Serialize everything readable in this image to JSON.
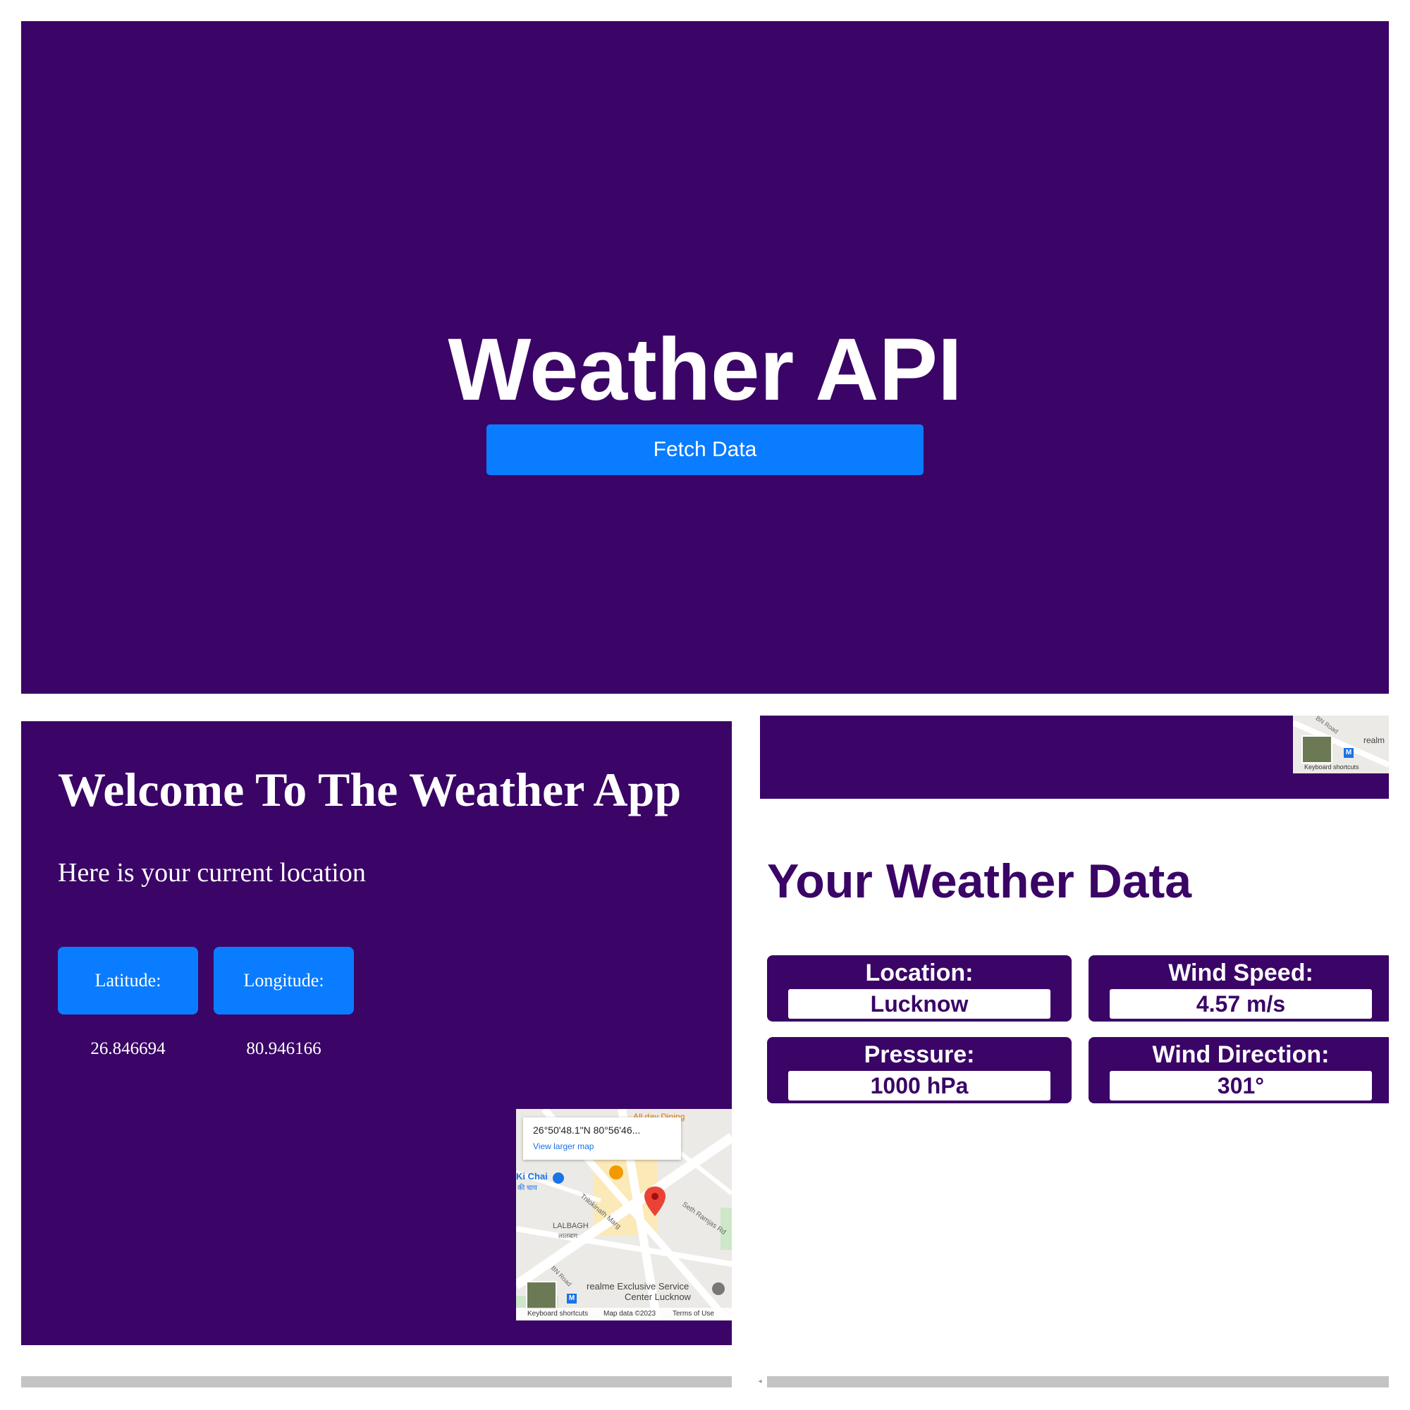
{
  "top": {
    "title": "Weather API",
    "fetch_button": "Fetch Data"
  },
  "welcome": {
    "title": "Welcome To The Weather App",
    "subtitle": "Here is your current location",
    "latitude_label": "Latitude:",
    "longitude_label": "Longitude:",
    "latitude_value": "26.846694",
    "longitude_value": "80.946166"
  },
  "map": {
    "coords": "26°50'48.1\"N 80°56'46...",
    "view_larger": "View larger map",
    "labels": {
      "dining": "All day Dining",
      "chai": "Ki Chai",
      "chai_hi": "की चाय",
      "lalbagh": "LALBAGH",
      "lalbagh_hi": "लालबाग",
      "trilokinath": "Trilokinath Marg",
      "seth": "Seth Ramjas Rd",
      "bn_road": "BN Road",
      "realme": "realme Exclusive Service",
      "center": "Center Lucknow",
      "metro": "M"
    },
    "footer": {
      "shortcuts": "Keyboard shortcuts",
      "map_data": "Map data ©2023",
      "terms": "Terms of Use"
    },
    "mini": {
      "bn_road": "BN Road",
      "realme": "realm",
      "shortcuts": "Keyboard shortcuts"
    }
  },
  "weather": {
    "title": "Your Weather Data",
    "location_label": "Location:",
    "location_value": "Lucknow",
    "wind_speed_label": "Wind Speed:",
    "wind_speed_value": "4.57 m/s",
    "pressure_label": "Pressure:",
    "pressure_value": "1000 hPa",
    "wind_direction_label": "Wind Direction:",
    "wind_direction_value": "301°"
  },
  "colors": {
    "panel_bg": "#3a0566",
    "button_blue": "#0a7cff",
    "text_white": "#ffffff"
  }
}
